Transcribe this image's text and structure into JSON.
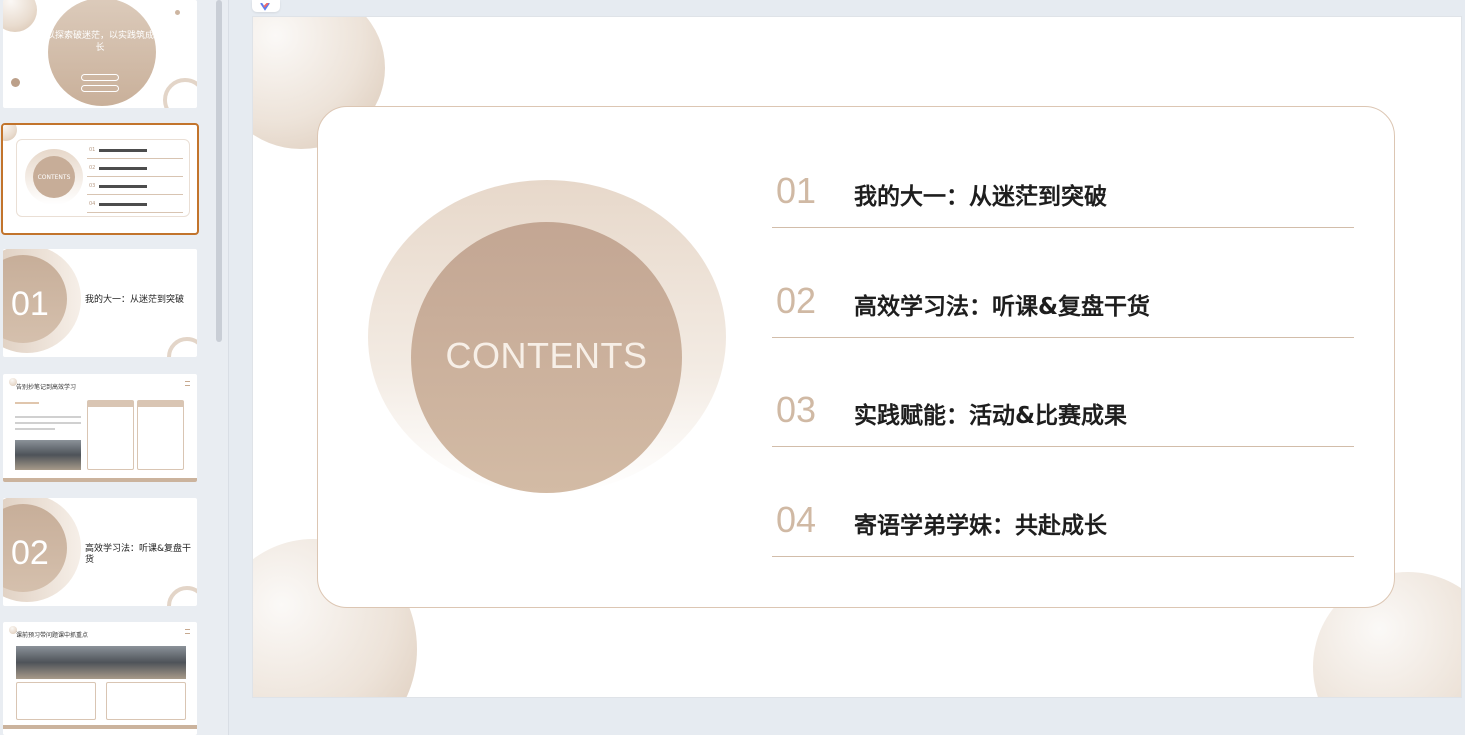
{
  "sidebar": {
    "thumbs": [
      {
        "title": "以探索破迷茫，以实践筑成长"
      },
      {
        "toc": [
          "01",
          "02",
          "03",
          "04"
        ],
        "contents": "CONTENTS"
      },
      {
        "num": "01",
        "text": "我的大一：从迷茫到突破"
      },
      {
        "title": "告别抄笔记到高效学习"
      },
      {
        "num": "02",
        "text": "高效学习法：听课&复盘干货"
      },
      {
        "title": "课前预习带问题课中抓重点"
      }
    ]
  },
  "slide": {
    "contents_label": "CONTENTS",
    "items": [
      {
        "num": "01",
        "title": "我的大一：从迷茫到突破"
      },
      {
        "num": "02",
        "title": "高效学习法：听课&复盘干货"
      },
      {
        "num": "03",
        "title": "实践赋能：活动&比赛成果"
      },
      {
        "num": "04",
        "title": "寄语学弟学妹：共赴成长"
      }
    ]
  },
  "colors": {
    "accent": "#c2742c",
    "beige": "#c3a693",
    "num": "#d0b9a4"
  }
}
